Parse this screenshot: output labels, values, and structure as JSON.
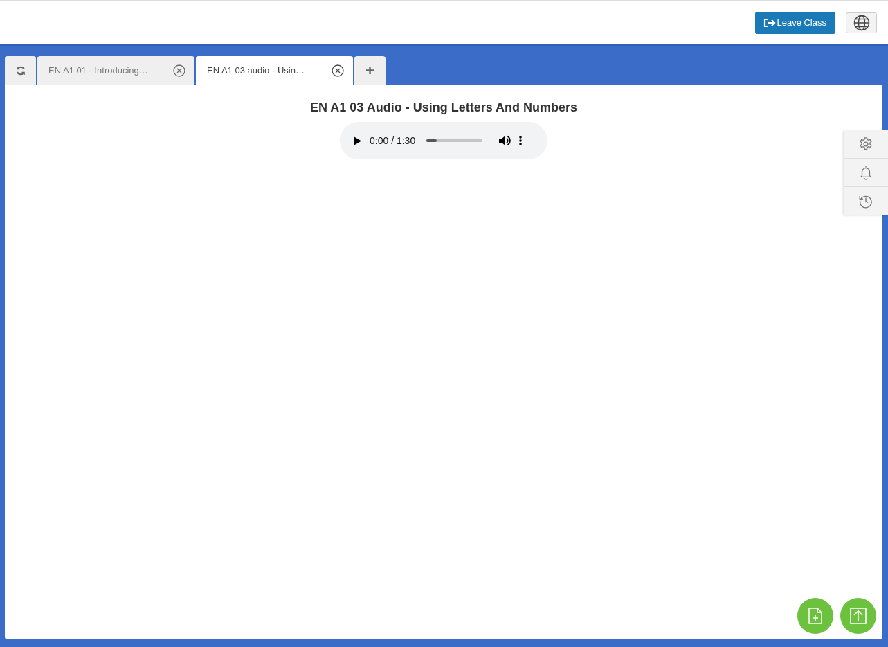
{
  "header": {
    "leave_button": "Leave Class"
  },
  "tabs": [
    {
      "label": "EN A1 01 - Introducing…",
      "selected": false
    },
    {
      "label": "EN A1 03 audio - Usin…",
      "selected": true
    }
  ],
  "content": {
    "title": "EN A1 03 Audio - Using Letters And Numbers",
    "audio": {
      "time": "0:00 / 1:30",
      "level": 0.18
    }
  }
}
